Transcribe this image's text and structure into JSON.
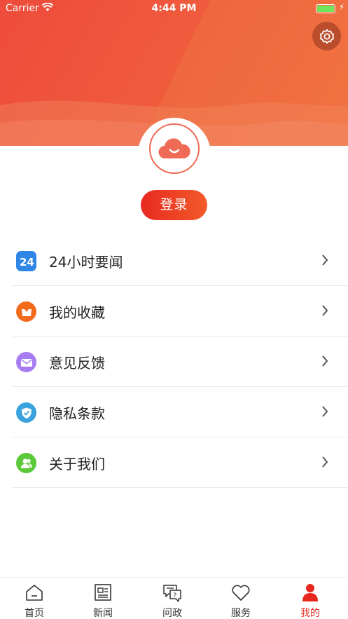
{
  "status_bar": {
    "carrier": "Carrier",
    "time": "4:44 PM"
  },
  "header": {
    "settings_icon": "gear-icon",
    "avatar_icon": "cloud-smile-icon"
  },
  "login": {
    "label": "登录"
  },
  "menu": [
    {
      "label": "24小时要闻",
      "icon": "24-hour-icon",
      "color": "#2f86e6"
    },
    {
      "label": "我的收藏",
      "icon": "favorites-box-icon",
      "color": "#f26b1d"
    },
    {
      "label": "意见反馈",
      "icon": "envelope-icon",
      "color": "#a77cf2"
    },
    {
      "label": "隐私条款",
      "icon": "shield-check-icon",
      "color": "#3aa2dd"
    },
    {
      "label": "关于我们",
      "icon": "people-icon",
      "color": "#5cc93a"
    }
  ],
  "tabbar": [
    {
      "label": "首页",
      "icon": "home-icon"
    },
    {
      "label": "新闻",
      "icon": "newspaper-icon"
    },
    {
      "label": "问政",
      "icon": "question-chat-icon"
    },
    {
      "label": "服务",
      "icon": "heart-icon"
    },
    {
      "label": "我的",
      "icon": "person-icon",
      "active": true
    }
  ],
  "colors": {
    "accent": "#e8281e",
    "header": "#ee5a3d"
  }
}
